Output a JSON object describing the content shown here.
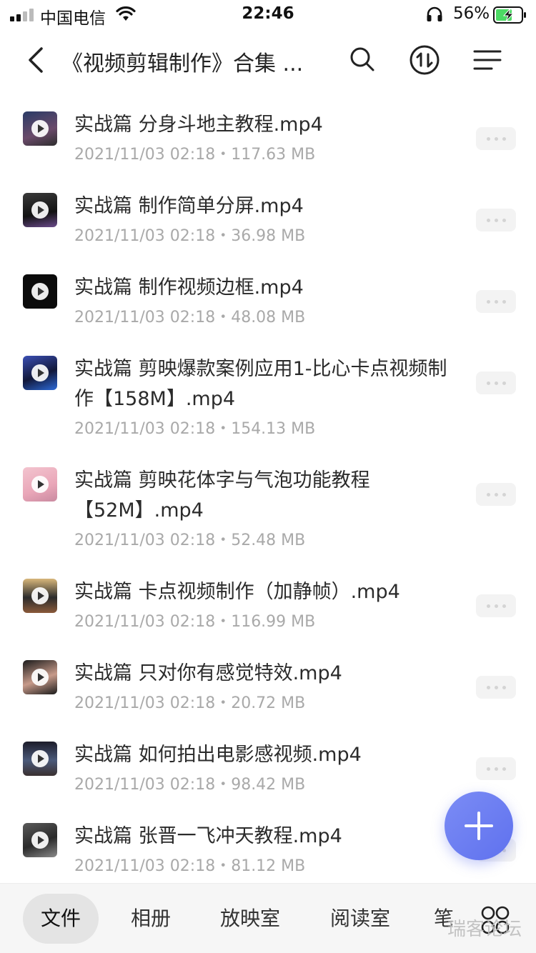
{
  "status_bar": {
    "carrier": "中国电信",
    "time": "22:46",
    "battery_percent": "56%"
  },
  "nav": {
    "title": "《视频剪辑制作》合集 ...",
    "icons": [
      "back-icon",
      "search-icon",
      "sort-icon",
      "menu-icon"
    ]
  },
  "files": [
    {
      "name": "实战篇 分身斗地主教程.mp4",
      "meta": "2021/11/03 02:18・117.63 MB"
    },
    {
      "name": "实战篇 制作简单分屏.mp4",
      "meta": "2021/11/03 02:18・36.98 MB"
    },
    {
      "name": "实战篇 制作视频边框.mp4",
      "meta": "2021/11/03 02:18・48.08 MB"
    },
    {
      "name": "实战篇 剪映爆款案例应用1-比心卡点视频制作【158M】.mp4",
      "meta": "2021/11/03 02:18・154.13 MB"
    },
    {
      "name": "实战篇 剪映花体字与气泡功能教程【52M】.mp4",
      "meta": "2021/11/03 02:18・52.48 MB"
    },
    {
      "name": "实战篇 卡点视频制作（加静帧）.mp4",
      "meta": "2021/11/03 02:18・116.99 MB"
    },
    {
      "name": "实战篇 只对你有感觉特效.mp4",
      "meta": "2021/11/03 02:18・20.72 MB"
    },
    {
      "name": "实战篇 如何拍出电影感视频.mp4",
      "meta": "2021/11/03 02:18・98.42 MB"
    },
    {
      "name": "实战篇 张晋一飞冲天教程.mp4",
      "meta": "2021/11/03 02:18・81.12 MB"
    }
  ],
  "tabs": [
    {
      "label": "文件",
      "active": true
    },
    {
      "label": "相册",
      "active": false
    },
    {
      "label": "放映室",
      "active": false
    },
    {
      "label": "阅读室",
      "active": false
    },
    {
      "label": "笔",
      "active": false
    }
  ],
  "watermark": "瑞客论坛",
  "colors": {
    "accent": "#6677f0",
    "meta_text": "#a9a9a9",
    "tab_bar": "#f6f6f6"
  }
}
